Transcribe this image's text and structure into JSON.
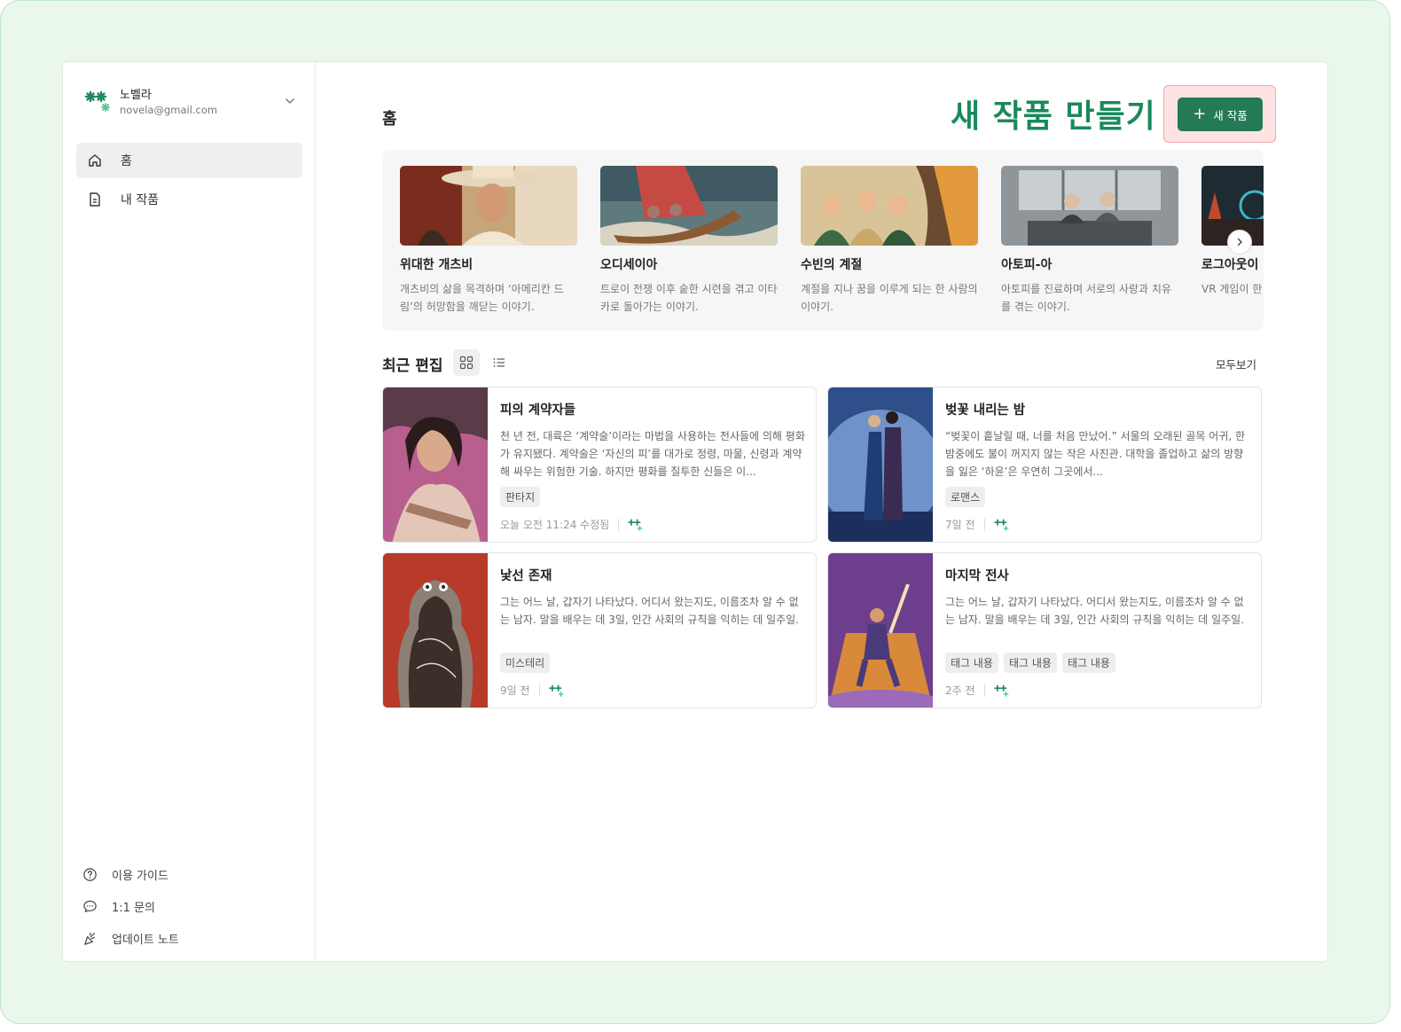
{
  "account": {
    "name": "노벨라",
    "email": "novela@gmail.com"
  },
  "nav": [
    {
      "label": "홈",
      "icon": "home-icon",
      "active": true
    },
    {
      "label": "내 작품",
      "icon": "document-icon",
      "active": false
    }
  ],
  "footer": [
    {
      "label": "이용 가이드",
      "icon": "help-circle-icon"
    },
    {
      "label": "1:1 문의",
      "icon": "chat-bubble-icon"
    },
    {
      "label": "업데이트 노트",
      "icon": "party-popper-icon"
    }
  ],
  "header": {
    "page_title": "홈",
    "hero_title": "새 작품 만들기",
    "new_button": "새 작품"
  },
  "featured": [
    {
      "title": "위대한 개츠비",
      "desc": "개츠비의 삶을 목격하며 ‘아메리칸 드림’의 허망함을 깨닫는 이야기."
    },
    {
      "title": "오디세이아",
      "desc": "트로이 전쟁 이후 숱한 시련을 겪고 이타카로 돌아가는 이야기."
    },
    {
      "title": "수빈의 계절",
      "desc": "계절을 지나 꿈을 이루게 되는 한 사람의 이야기."
    },
    {
      "title": "아토피-아",
      "desc": "아토피를 진료하며 서로의 사랑과 치유를 겪는 이야기."
    },
    {
      "title": "로그아웃이",
      "desc": "VR 게임이 한 진실을 위해 /"
    }
  ],
  "recent": {
    "title": "최근 편집",
    "see_all": "모두보기",
    "works": [
      {
        "title": "피의 계약자들",
        "desc": "천 년 전, 대륙은 ‘계약술’이라는 마법을 사용하는 전사들에 의해 평화가 유지됐다. 계약술은 ‘자신의 피’를 대가로 정령, 마물, 신령과 계약해 싸우는 위험한 기술. 하지만 평화를 질투한 신들은 이...",
        "tags": [
          "판타지"
        ],
        "time": "오늘 오전 11:24 수정됨"
      },
      {
        "title": "벚꽃 내리는 밤",
        "desc": "“벚꽃이 흩날릴 때, 너를 처음 만났어.” 서울의 오래된 골목 어귀, 한밤중에도 불이 꺼지지 않는 작은 사진관. 대학을 졸업하고 삶의 방향을 잃은 ‘하윤’은 우연히 그곳에서...",
        "tags": [
          "로맨스"
        ],
        "time": "7일 전"
      },
      {
        "title": "낯선 존재",
        "desc": "그는 어느 날, 갑자기 나타났다. 어디서 왔는지도, 이름조차 알 수 없는 남자. 말을 배우는 데 3일, 인간 사회의 규칙을 익히는 데 일주일.",
        "tags": [
          "미스테리"
        ],
        "time": "9일 전"
      },
      {
        "title": "마지막 전사",
        "desc": "그는 어느 날, 갑자기 나타났다. 어디서 왔는지도, 이름조차 알 수 없는 남자. 말을 배우는 데 3일, 인간 사회의 규칙을 익히는 데 일주일.",
        "tags": [
          "태그 내용",
          "태그 내용",
          "태그 내용"
        ],
        "time": "2주 전"
      }
    ]
  },
  "colors": {
    "brand": "#237a55",
    "hero": "#1a8a5a",
    "highlight": "#fde3e3"
  }
}
